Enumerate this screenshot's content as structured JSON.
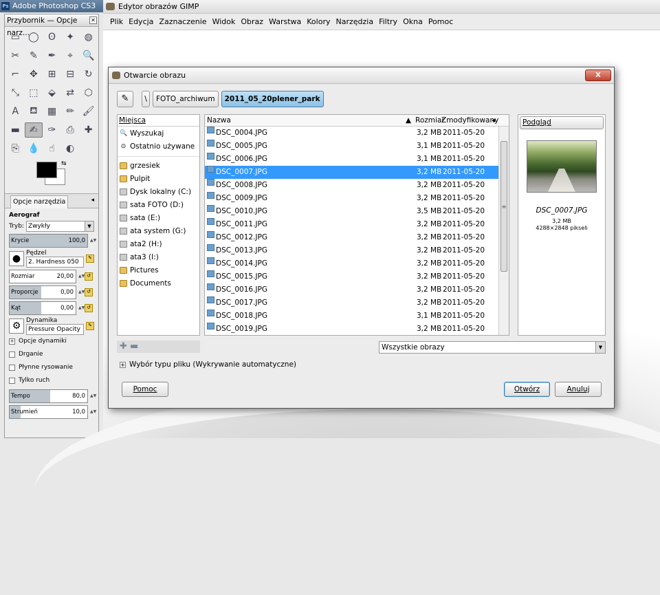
{
  "photoshop": {
    "title": "Adobe Photoshop CS3",
    "logo": "Ps"
  },
  "toolbox": {
    "title": "Przybornik — Opcje narz...",
    "tools": [
      "rect-select-icon",
      "ellipse-select-icon",
      "lasso-icon",
      "fuzzy-select-icon",
      "color-select-icon",
      "scissors-icon",
      "foreground-select-icon",
      "paths-icon",
      "color-picker-icon",
      "zoom-icon",
      "measure-icon",
      "move-icon",
      "align-icon",
      "crop-icon",
      "rotate-icon",
      "scale-icon",
      "shear-icon",
      "perspective-icon",
      "flip-icon",
      "cage-icon",
      "text-icon",
      "bucket-fill-icon",
      "blend-icon",
      "pencil-icon",
      "paintbrush-icon",
      "eraser-icon",
      "airbrush-icon",
      "ink-icon",
      "clone-icon",
      "heal-icon",
      "perspective-clone-icon",
      "blur-icon",
      "smudge-icon",
      "dodge-icon"
    ],
    "tool_glyphs": [
      "▭",
      "◯",
      "ʘ",
      "✦",
      "◍",
      "✂",
      "✎",
      "✒",
      "⌖",
      "🔍",
      "⌐",
      "✥",
      "⊞",
      "⊟",
      "↻",
      "⤡",
      "⬚",
      "⬙",
      "⇄",
      "⬡",
      "A",
      "⛾",
      "▦",
      "✏",
      "🖌",
      "▬",
      "✍",
      "✑",
      "⎙",
      "✚",
      "⎘",
      "💧",
      "☝",
      "◐"
    ],
    "selected_tool_index": 26,
    "tab_label": "Opcje narzędzia",
    "options": {
      "heading": "Aerograf",
      "mode_label": "Tryb:",
      "mode_value": "Zwykły",
      "opacity_label": "Krycie",
      "opacity_value": "100,0",
      "brush_label": "Pędzel",
      "brush_value": "2. Hardness 050",
      "size_label": "Rozmiar",
      "size_value": "20,00",
      "aspect_label": "Proporcje",
      "aspect_value": "0,00",
      "angle_label": "Kąt",
      "angle_value": "0,00",
      "dynamics_label": "Dynamika",
      "dynamics_value": "Pressure Opacity",
      "dynamics_options": "Opcje dynamiki",
      "jitter": "Drganie",
      "smooth": "Płynne rysowanie",
      "behind": "Tylko ruch",
      "rate_label": "Tempo",
      "rate_value": "80,0",
      "flow_label": "Strumień",
      "flow_value": "10,0"
    }
  },
  "gimp": {
    "title": "Edytor obrazów GIMP",
    "menu": [
      "Plik",
      "Edycja",
      "Zaznaczenie",
      "Widok",
      "Obraz",
      "Warstwa",
      "Kolory",
      "Narzędzia",
      "Filtry",
      "Okna",
      "Pomoc"
    ]
  },
  "dialog": {
    "title": "Otwarcie obrazu",
    "close": "X",
    "path": {
      "sep": "\\",
      "crumbs": [
        "FOTO_archiwum",
        "2011_05_20plener_park"
      ]
    },
    "places_header": "Miejsca",
    "places": [
      {
        "label": "Wyszukaj",
        "icon": "search-icon",
        "glyph": "🔍",
        "kind": ""
      },
      {
        "label": "Ostatnio używane",
        "icon": "recent-icon",
        "glyph": "⊙",
        "kind": ""
      },
      {
        "label": "grzesiek",
        "icon": "folder-icon",
        "glyph": "",
        "kind": "fold",
        "sep": true
      },
      {
        "label": "Pulpit",
        "icon": "folder-icon",
        "glyph": "",
        "kind": "fold"
      },
      {
        "label": "Dysk lokalny (C:)",
        "icon": "drive-icon",
        "glyph": "",
        "kind": "drv"
      },
      {
        "label": "sata FOTO (D:)",
        "icon": "drive-icon",
        "glyph": "",
        "kind": "drv"
      },
      {
        "label": "sata (E:)",
        "icon": "drive-icon",
        "glyph": "",
        "kind": "drv"
      },
      {
        "label": "ata system (G:)",
        "icon": "drive-icon",
        "glyph": "",
        "kind": "drv"
      },
      {
        "label": "ata2 (H:)",
        "icon": "drive-icon",
        "glyph": "",
        "kind": "drv"
      },
      {
        "label": "ata3 (I:)",
        "icon": "drive-icon",
        "glyph": "",
        "kind": "drv"
      },
      {
        "label": "Pictures",
        "icon": "folder-icon",
        "glyph": "",
        "kind": "fold"
      },
      {
        "label": "Documents",
        "icon": "folder-icon",
        "glyph": "",
        "kind": "fold"
      }
    ],
    "columns": {
      "name": "Nazwa",
      "size": "Rozmiar",
      "modified": "Zmodyfikowany"
    },
    "files": [
      {
        "name": "DSC_0004.JPG",
        "size": "3,2 MB",
        "date": "2011-05-20"
      },
      {
        "name": "DSC_0005.JPG",
        "size": "3,1 MB",
        "date": "2011-05-20"
      },
      {
        "name": "DSC_0006.JPG",
        "size": "3,1 MB",
        "date": "2011-05-20"
      },
      {
        "name": "DSC_0007.JPG",
        "size": "3,2 MB",
        "date": "2011-05-20",
        "selected": true
      },
      {
        "name": "DSC_0008.JPG",
        "size": "3,2 MB",
        "date": "2011-05-20"
      },
      {
        "name": "DSC_0009.JPG",
        "size": "3,2 MB",
        "date": "2011-05-20"
      },
      {
        "name": "DSC_0010.JPG",
        "size": "3,5 MB",
        "date": "2011-05-20"
      },
      {
        "name": "DSC_0011.JPG",
        "size": "3,2 MB",
        "date": "2011-05-20"
      },
      {
        "name": "DSC_0012.JPG",
        "size": "3,2 MB",
        "date": "2011-05-20"
      },
      {
        "name": "DSC_0013.JPG",
        "size": "3,2 MB",
        "date": "2011-05-20"
      },
      {
        "name": "DSC_0014.JPG",
        "size": "3,2 MB",
        "date": "2011-05-20"
      },
      {
        "name": "DSC_0015.JPG",
        "size": "3,2 MB",
        "date": "2011-05-20"
      },
      {
        "name": "DSC_0016.JPG",
        "size": "3,2 MB",
        "date": "2011-05-20"
      },
      {
        "name": "DSC_0017.JPG",
        "size": "3,2 MB",
        "date": "2011-05-20"
      },
      {
        "name": "DSC_0018.JPG",
        "size": "3,1 MB",
        "date": "2011-05-20"
      },
      {
        "name": "DSC_0019.JPG",
        "size": "3,2 MB",
        "date": "2011-05-20"
      }
    ],
    "preview": {
      "button": "Podgląd",
      "filename": "DSC_0007.JPG",
      "size": "3,2 MB",
      "dimensions": "4288×2848 pikseli"
    },
    "filter": "Wszystkie obrazy",
    "filetype_expander": "Wybór typu pliku (Wykrywanie automatyczne)",
    "buttons": {
      "help": "Pomoc",
      "open": "Otwórz",
      "cancel": "Anuluj"
    }
  },
  "colors": {
    "selection": "#3399ff",
    "close_button": "#c0402e",
    "crumb_active": "#8cc2e6"
  }
}
